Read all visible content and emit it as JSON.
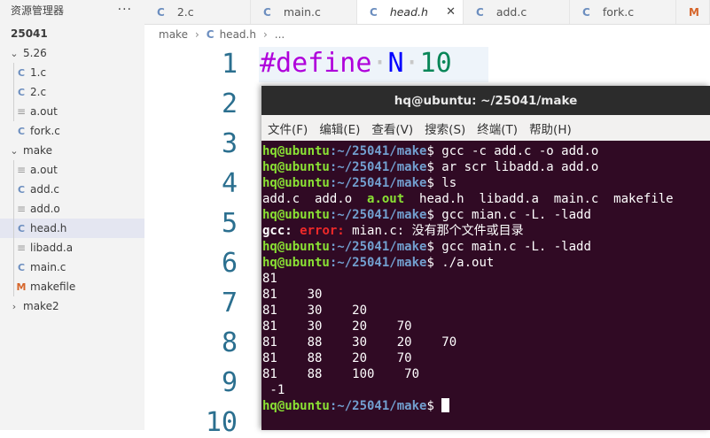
{
  "sidebar": {
    "title": "资源管理器",
    "more": "···",
    "tree": [
      {
        "label": "25041",
        "chevron": "",
        "icon": "",
        "kind": "root"
      },
      {
        "label": "5.26",
        "chevron": "⌄",
        "icon": "",
        "kind": "folder"
      },
      {
        "label": "1.c",
        "chevron": "",
        "icon": "C",
        "kind": "c"
      },
      {
        "label": "2.c",
        "chevron": "",
        "icon": "C",
        "kind": "c"
      },
      {
        "label": "a.out",
        "chevron": "",
        "icon": "≡",
        "kind": "bin"
      },
      {
        "label": "fork.c",
        "chevron": "",
        "icon": "C",
        "kind": "c"
      },
      {
        "label": "make",
        "chevron": "⌄",
        "icon": "",
        "kind": "folder"
      },
      {
        "label": "a.out",
        "chevron": "",
        "icon": "≡",
        "kind": "bin"
      },
      {
        "label": "add.c",
        "chevron": "",
        "icon": "C",
        "kind": "c"
      },
      {
        "label": "add.o",
        "chevron": "",
        "icon": "≡",
        "kind": "bin"
      },
      {
        "label": "head.h",
        "chevron": "",
        "icon": "C",
        "kind": "c"
      },
      {
        "label": "libadd.a",
        "chevron": "",
        "icon": "≡",
        "kind": "bin"
      },
      {
        "label": "main.c",
        "chevron": "",
        "icon": "C",
        "kind": "c"
      },
      {
        "label": "makefile",
        "chevron": "",
        "icon": "M",
        "kind": "mk"
      },
      {
        "label": "make2",
        "chevron": "›",
        "icon": "",
        "kind": "folder"
      }
    ]
  },
  "tabs": [
    {
      "label": "2.c",
      "icon": "C"
    },
    {
      "label": "main.c",
      "icon": "C"
    },
    {
      "label": "head.h",
      "icon": "C",
      "close": "✕"
    },
    {
      "label": "add.c",
      "icon": "C"
    },
    {
      "label": "fork.c",
      "icon": "C"
    },
    {
      "label": "m",
      "icon": "M"
    }
  ],
  "breadcrumb": {
    "part1": "make",
    "sep": "›",
    "icon": "C",
    "part2": "head.h",
    "part3": "..."
  },
  "editor": {
    "line_numbers": [
      "1",
      "2",
      "3",
      "4",
      "5",
      "6",
      "7",
      "8",
      "9",
      "10"
    ],
    "code": {
      "directive": "#define",
      "dot1": "·",
      "name": "N",
      "dot2": "·",
      "value": "10"
    }
  },
  "terminal": {
    "title": "hq@ubuntu: ~/25041/make",
    "menu": [
      "文件(F)",
      "编辑(E)",
      "查看(V)",
      "搜索(S)",
      "终端(T)",
      "帮助(H)"
    ],
    "user": "hq@ubuntu",
    "path": ":~/25041/make",
    "cmds": [
      "$ gcc -c add.c -o add.o",
      "$ ar scr libadd.a add.o",
      "$ ls",
      "$ gcc mian.c -L. -ladd",
      "$ gcc main.c -L. -ladd",
      "$ ./a.out",
      "$ "
    ],
    "ls_before": "add.c  add.o  ",
    "ls_exe": "a.out",
    "ls_after": "  head.h  libadd.a  main.c  makefile",
    "err_prog": "gcc: ",
    "err_label": "error: ",
    "err_msg": "mian.c: 没有那个文件或目录",
    "output": [
      "81",
      "81    30",
      "81    30    20",
      "81    30    20    70",
      "81    88    30    20    70",
      "81    88    20    70",
      "81    88    100    70",
      " -1"
    ]
  }
}
